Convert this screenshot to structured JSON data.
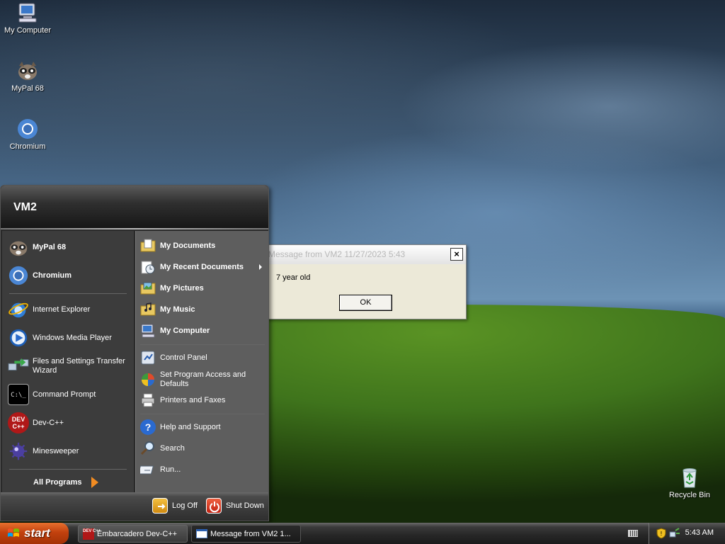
{
  "desktop": {
    "icons": [
      {
        "label": "My Computer",
        "icon": "my-computer-icon"
      },
      {
        "label": "MyPal 68",
        "icon": "mypal-icon"
      },
      {
        "label": "Chromium",
        "icon": "chromium-icon"
      },
      {
        "label": "Recycle Bin",
        "icon": "recycle-bin-icon"
      }
    ]
  },
  "start_menu": {
    "user": "VM2",
    "pinned": [
      {
        "label": "MyPal 68",
        "icon": "mypal-icon"
      },
      {
        "label": "Chromium",
        "icon": "chromium-icon"
      }
    ],
    "recent": [
      {
        "label": "Internet Explorer",
        "icon": "internet-explorer-icon"
      },
      {
        "label": "Windows Media Player",
        "icon": "media-player-icon"
      },
      {
        "label": "Files and Settings Transfer Wizard",
        "icon": "transfer-wizard-icon"
      },
      {
        "label": "Command Prompt",
        "icon": "command-prompt-icon"
      },
      {
        "label": "Dev-C++",
        "icon": "dev-cpp-icon"
      },
      {
        "label": "Minesweeper",
        "icon": "minesweeper-icon"
      }
    ],
    "all_programs": "All Programs",
    "places": [
      {
        "label": "My Documents",
        "icon": "documents-folder-icon"
      },
      {
        "label": "My Recent Documents",
        "icon": "recent-documents-icon"
      },
      {
        "label": "My Pictures",
        "icon": "pictures-folder-icon"
      },
      {
        "label": "My Music",
        "icon": "music-folder-icon"
      },
      {
        "label": "My Computer",
        "icon": "my-computer-icon"
      }
    ],
    "settings": [
      {
        "label": "Control Panel",
        "icon": "control-panel-icon"
      },
      {
        "label": "Set Program Access and Defaults",
        "icon": "program-access-icon"
      },
      {
        "label": "Printers and Faxes",
        "icon": "printer-icon"
      }
    ],
    "tools": [
      {
        "label": "Help and Support",
        "icon": "help-icon"
      },
      {
        "label": "Search",
        "icon": "search-icon"
      },
      {
        "label": "Run...",
        "icon": "run-icon"
      }
    ],
    "log_off": "Log Off",
    "shut_down": "Shut Down"
  },
  "dialog": {
    "title": "Message from VM2 11/27/2023 5:43",
    "close": "×",
    "message": "7 year old",
    "ok": "OK"
  },
  "taskbar": {
    "start": "start",
    "tasks": [
      {
        "label": "Embarcadero Dev-C++",
        "icon": "dev-cpp-icon"
      },
      {
        "label": "Message from VM2 1...",
        "icon": "window-icon"
      }
    ],
    "clock": "5:43 AM"
  },
  "colors": {
    "start_button": "#c2410e",
    "menu_dark": "#3c3c3c",
    "menu_light": "#5e5e5e",
    "dialog_bg": "#ece9d8"
  }
}
